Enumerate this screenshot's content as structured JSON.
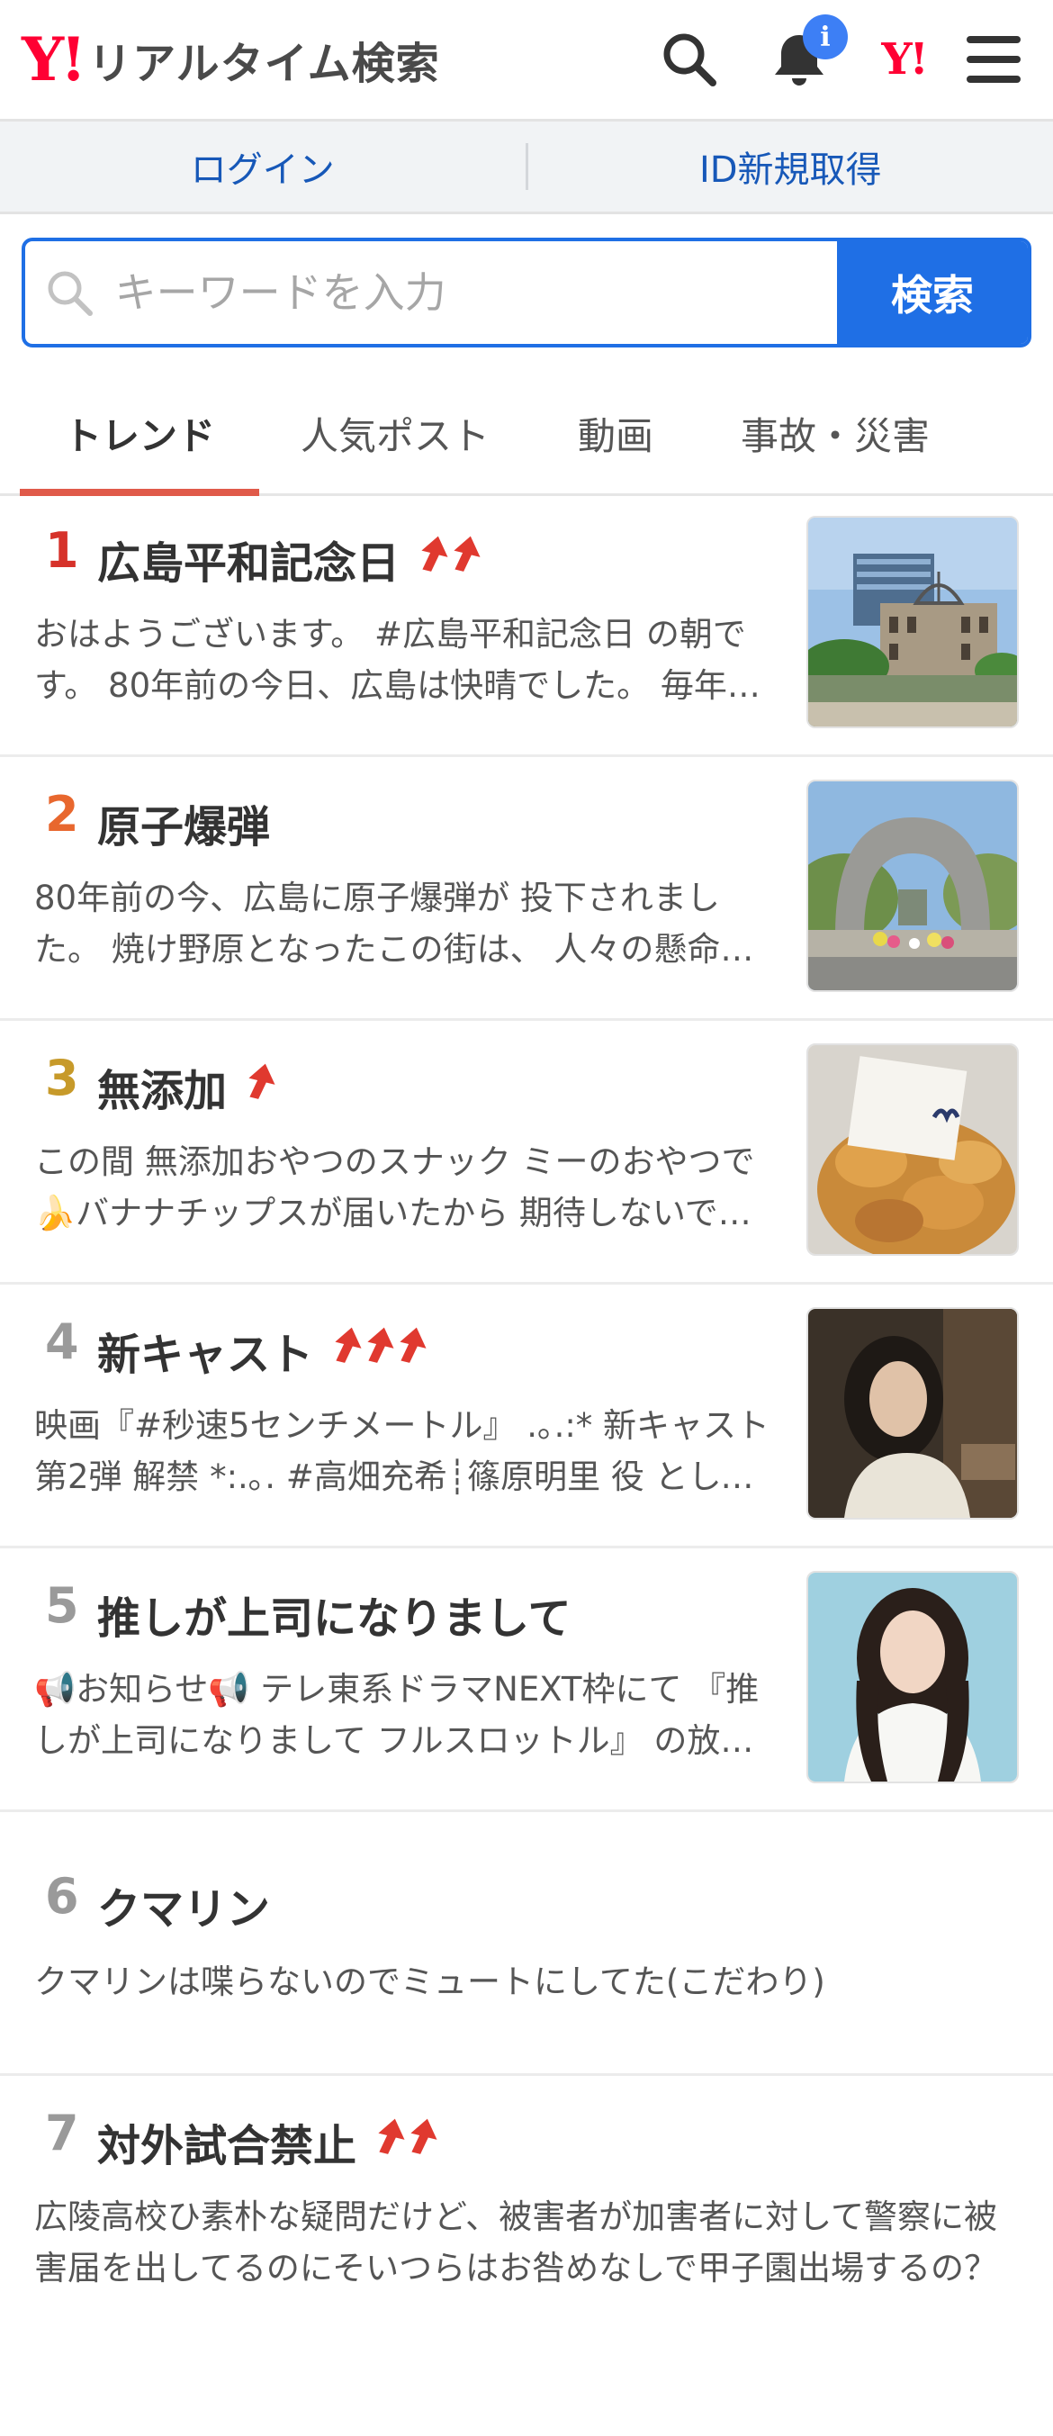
{
  "header": {
    "logo_mark": "Y!",
    "logo_text": "リアルタイム検索",
    "notification_badge": "i",
    "yahoo_mark": "Y!"
  },
  "auth": {
    "login": "ログイン",
    "register": "ID新規取得"
  },
  "search": {
    "placeholder": "キーワードを入力",
    "button": "検索"
  },
  "tabs": [
    "トレンド",
    "人気ポスト",
    "動画",
    "事故・災害"
  ],
  "trends": [
    {
      "rank": "1",
      "title": "広島平和記念日",
      "arrows": 2,
      "rank_color": "#d6322a",
      "text": "おはようございます。 #広島平和記念日 の朝です。 80年前の今日、広島は快晴でした。 毎年、夏になると、その日のことを思います。"
    },
    {
      "rank": "2",
      "title": "原子爆弾",
      "arrows": 0,
      "rank_color": "#e8672e",
      "text": "80年前の今、広島に原子爆弾が 投下されました。 焼け野原となったこの街は、 人々の懸命な努力によって復興しました。"
    },
    {
      "rank": "3",
      "title": "無添加",
      "arrows": 1,
      "rank_color": "#c79a2a",
      "text": "この間 無添加おやつのスナック ミーのおやつで🍌バナナチップスが届いたから 期待しないで食べてみたら美味しかった"
    },
    {
      "rank": "4",
      "title": "新キャスト",
      "arrows": 3,
      "rank_color": "#9a9a9a",
      "text": "映画『#秒速5センチメートル』 .｡.:* 新キャスト第2弾 解禁 *:.｡. #高畑充希┊篠原明里 役 として出演が決定しました"
    },
    {
      "rank": "5",
      "title": "推しが上司になりまして",
      "arrows": 0,
      "rank_color": "#9a9a9a",
      "text": "📢お知らせ📢 テレ東系ドラマNEXT枠にて 『推しが上司になりまして フルスロットル』 の放送が決定しました"
    },
    {
      "rank": "6",
      "title": "クマリン",
      "arrows": 0,
      "rank_color": "#9a9a9a",
      "text": "クマリンは喋らないのでミュートにしてた(こだわり)"
    },
    {
      "rank": "7",
      "title": "対外試合禁止",
      "arrows": 2,
      "rank_color": "#9a9a9a",
      "text": "広陵高校ひ素朴な疑問だけど、被害者が加害者に対して警察に被害届を出してるのにそいつらはお咎めなしで甲子園出場するの？"
    }
  ],
  "colors": {
    "accent_blue": "#1f6fe5",
    "brand_red": "#ff0033",
    "tab_underline": "#e05a4a",
    "arrow_red": "#e0392f"
  }
}
